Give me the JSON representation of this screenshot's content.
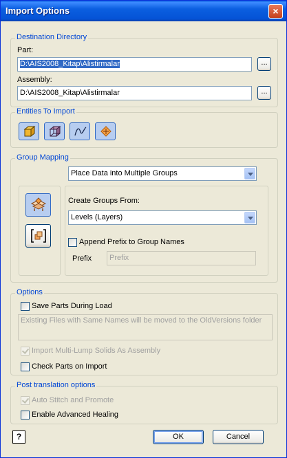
{
  "window": {
    "title": "Import Options",
    "close_label": "×"
  },
  "destination": {
    "legend": "Destination Directory",
    "part_label": "Part:",
    "part_value": "D:\\AIS2008_Kitap\\Alistirmalar",
    "assembly_label": "Assembly:",
    "assembly_value": "D:\\AIS2008_Kitap\\Alistirmalar",
    "browse_label": "..."
  },
  "entities": {
    "legend": "Entities To Import",
    "buttons": [
      {
        "icon": "solid-icon",
        "pressed": true
      },
      {
        "icon": "surface-icon",
        "pressed": true
      },
      {
        "icon": "curve-icon",
        "pressed": true
      },
      {
        "icon": "point-icon",
        "pressed": true
      }
    ]
  },
  "group_mapping": {
    "legend": "Group Mapping",
    "mode_value": "Place Data into Multiple Groups",
    "create_groups_label": "Create Groups From:",
    "create_groups_value": "Levels (Layers)",
    "append_prefix_label": "Append Prefix to Group Names",
    "append_prefix_checked": false,
    "prefix_label": "Prefix",
    "prefix_value": "Prefix"
  },
  "options": {
    "legend": "Options",
    "save_parts_label": "Save Parts During Load",
    "save_parts_checked": false,
    "save_parts_note": "Existing Files with Same Names will be moved to the OldVersions folder",
    "multi_lump_label": "Import Multi-Lump Solids As Assembly",
    "multi_lump_checked": true,
    "check_parts_label": "Check Parts on Import",
    "check_parts_checked": false
  },
  "post_translation": {
    "legend": "Post translation options",
    "auto_stitch_label": "Auto Stitch and Promote",
    "auto_stitch_checked": true,
    "advanced_healing_label": "Enable Advanced Healing",
    "advanced_healing_checked": false
  },
  "footer": {
    "help_label": "?",
    "ok_label": "OK",
    "cancel_label": "Cancel"
  },
  "colors": {
    "title_bar": "#0553d6",
    "legend_text": "#0046d5",
    "selection": "#316ac5"
  }
}
